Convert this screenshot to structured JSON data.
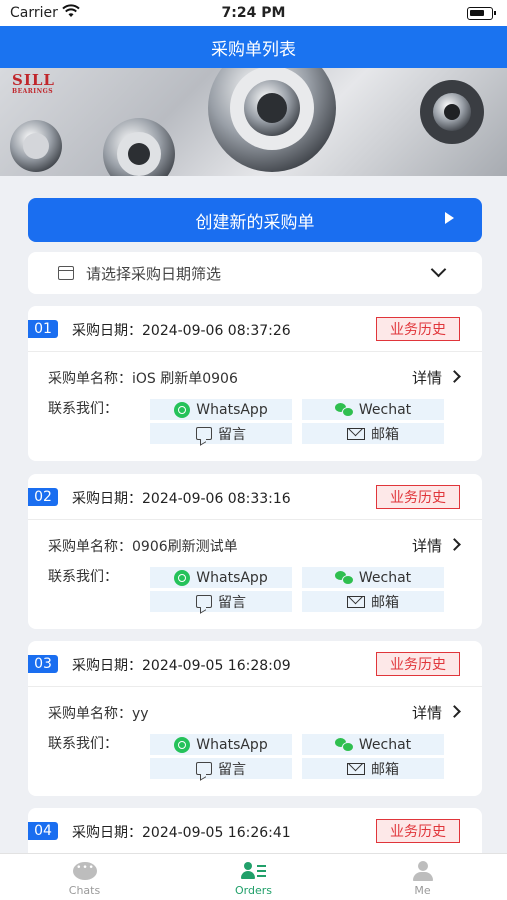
{
  "status_bar": {
    "carrier": "Carrier",
    "time": "7:24 PM"
  },
  "header": {
    "title": "采购单列表"
  },
  "banner": {
    "logo_text": "SILL",
    "logo_subtext": "BEARINGS"
  },
  "create_button": {
    "label": "创建新的采购单"
  },
  "date_filter": {
    "placeholder": "请选择采购日期筛选"
  },
  "orders": [
    {
      "index": "01",
      "date": "采购日期：2024-09-06 08:37:26",
      "history": "业务历史",
      "name": "采购单名称：iOS 刷新单0906",
      "detail": "详情",
      "contact_label": "联系我们：",
      "whatsapp": "WhatsApp",
      "wechat": "Wechat",
      "message": "留言",
      "email": "邮箱"
    },
    {
      "index": "02",
      "date": "采购日期：2024-09-06 08:33:16",
      "history": "业务历史",
      "name": "采购单名称：0906刷新测试单",
      "detail": "详情",
      "contact_label": "联系我们：",
      "whatsapp": "WhatsApp",
      "wechat": "Wechat",
      "message": "留言",
      "email": "邮箱"
    },
    {
      "index": "03",
      "date": "采购日期：2024-09-05 16:28:09",
      "history": "业务历史",
      "name": "采购单名称：yy",
      "detail": "详情",
      "contact_label": "联系我们：",
      "whatsapp": "WhatsApp",
      "wechat": "Wechat",
      "message": "留言",
      "email": "邮箱"
    },
    {
      "index": "04",
      "date": "采购日期：2024-09-05 16:26:41",
      "history": "业务历史"
    }
  ],
  "tab_bar": {
    "items": [
      {
        "label": "Chats",
        "icon": "chat-bubble-icon",
        "active": false
      },
      {
        "label": "Orders",
        "icon": "orders-icon",
        "active": true
      },
      {
        "label": "Me",
        "icon": "profile-icon",
        "active": false
      }
    ]
  },
  "colors": {
    "primary": "#1a6ef0",
    "history_red": "#e0353a",
    "tab_active": "#21a06a",
    "contact_bg": "#eaf3fb"
  }
}
